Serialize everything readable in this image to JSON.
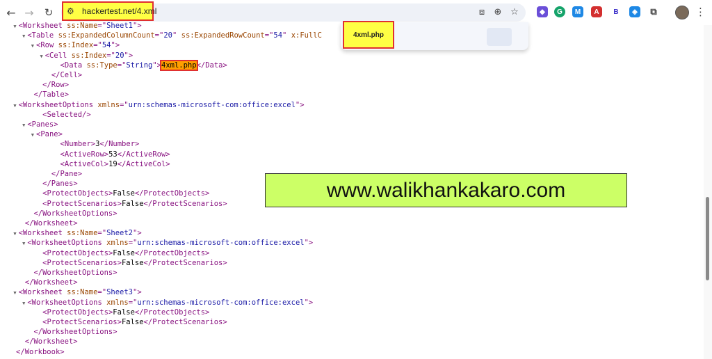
{
  "browser": {
    "url": "hackertest.net/4.xml",
    "back_icon": "←",
    "forward_icon": "→",
    "reload_icon": "↻",
    "site_info_icon": "⚙",
    "menu_icon": "⋮"
  },
  "find_popup": {
    "text": "4xml.php"
  },
  "xml_lines": [
    {
      "indent": 4,
      "tri": "▼",
      "segs": [
        [
          "tag",
          "<Worksheet "
        ],
        [
          "attr",
          "ss:Name"
        ],
        [
          "tag",
          "=\""
        ],
        [
          "val",
          "Sheet1"
        ],
        [
          "tag",
          "\">"
        ]
      ]
    },
    {
      "indent": 6,
      "tri": "▼",
      "segs": [
        [
          "tag",
          "<Table "
        ],
        [
          "attr",
          "ss:ExpandedColumnCount"
        ],
        [
          "tag",
          "=\""
        ],
        [
          "val",
          "20"
        ],
        [
          "tag",
          "\" "
        ],
        [
          "attr",
          "ss:ExpandedRowCount"
        ],
        [
          "tag",
          "=\""
        ],
        [
          "val",
          "54"
        ],
        [
          "tag",
          "\" "
        ],
        [
          "attr",
          "x:FullC"
        ]
      ]
    },
    {
      "indent": 8,
      "tri": "▼",
      "segs": [
        [
          "tag",
          "<Row "
        ],
        [
          "attr",
          "ss:Index"
        ],
        [
          "tag",
          "=\""
        ],
        [
          "val",
          "54"
        ],
        [
          "tag",
          "\">"
        ]
      ]
    },
    {
      "indent": 10,
      "tri": "▼",
      "segs": [
        [
          "tag",
          "<Cell "
        ],
        [
          "attr",
          "ss:Index"
        ],
        [
          "tag",
          "=\""
        ],
        [
          "val",
          "20"
        ],
        [
          "tag",
          "\">"
        ]
      ]
    },
    {
      "indent": 13,
      "tri": "",
      "segs": [
        [
          "tag",
          "<Data "
        ],
        [
          "attr",
          "ss:Type"
        ],
        [
          "tag",
          "=\""
        ],
        [
          "val",
          "String"
        ],
        [
          "tag",
          "\">"
        ],
        [
          "hl",
          "4xml.php"
        ],
        [
          "tag",
          "</Data>"
        ]
      ]
    },
    {
      "indent": 11,
      "tri": "",
      "segs": [
        [
          "tag",
          "</Cell>"
        ]
      ]
    },
    {
      "indent": 9,
      "tri": "",
      "segs": [
        [
          "tag",
          "</Row>"
        ]
      ]
    },
    {
      "indent": 7,
      "tri": "",
      "segs": [
        [
          "tag",
          "</Table>"
        ]
      ]
    },
    {
      "indent": 4,
      "tri": "▼",
      "segs": [
        [
          "tag",
          "<WorksheetOptions "
        ],
        [
          "attr",
          "xmlns"
        ],
        [
          "tag",
          "=\""
        ],
        [
          "val",
          "urn:schemas-microsoft-com:office:excel"
        ],
        [
          "tag",
          "\">"
        ]
      ]
    },
    {
      "indent": 9,
      "tri": "",
      "segs": [
        [
          "tag",
          "<Selected/>"
        ]
      ]
    },
    {
      "indent": 6,
      "tri": "▼",
      "segs": [
        [
          "tag",
          "<Panes>"
        ]
      ]
    },
    {
      "indent": 8,
      "tri": "▼",
      "segs": [
        [
          "tag",
          "<Pane>"
        ]
      ]
    },
    {
      "indent": 13,
      "tri": "",
      "segs": [
        [
          "tag",
          "<Number>"
        ],
        [
          "txt",
          "3"
        ],
        [
          "tag",
          "</Number>"
        ]
      ]
    },
    {
      "indent": 13,
      "tri": "",
      "segs": [
        [
          "tag",
          "<ActiveRow>"
        ],
        [
          "txt",
          "53"
        ],
        [
          "tag",
          "</ActiveRow>"
        ]
      ]
    },
    {
      "indent": 13,
      "tri": "",
      "segs": [
        [
          "tag",
          "<ActiveCol>"
        ],
        [
          "txt",
          "19"
        ],
        [
          "tag",
          "</ActiveCol>"
        ]
      ]
    },
    {
      "indent": 11,
      "tri": "",
      "segs": [
        [
          "tag",
          "</Pane>"
        ]
      ]
    },
    {
      "indent": 9,
      "tri": "",
      "segs": [
        [
          "tag",
          "</Panes>"
        ]
      ]
    },
    {
      "indent": 9,
      "tri": "",
      "segs": [
        [
          "tag",
          "<ProtectObjects>"
        ],
        [
          "txt",
          "False"
        ],
        [
          "tag",
          "</ProtectObjects>"
        ]
      ]
    },
    {
      "indent": 9,
      "tri": "",
      "segs": [
        [
          "tag",
          "<ProtectScenarios>"
        ],
        [
          "txt",
          "False"
        ],
        [
          "tag",
          "</ProtectScenarios>"
        ]
      ]
    },
    {
      "indent": 7,
      "tri": "",
      "segs": [
        [
          "tag",
          "</WorksheetOptions>"
        ]
      ]
    },
    {
      "indent": 5,
      "tri": "",
      "segs": [
        [
          "tag",
          "</Worksheet>"
        ]
      ]
    },
    {
      "indent": 4,
      "tri": "▼",
      "segs": [
        [
          "tag",
          "<Worksheet "
        ],
        [
          "attr",
          "ss:Name"
        ],
        [
          "tag",
          "=\""
        ],
        [
          "val",
          "Sheet2"
        ],
        [
          "tag",
          "\">"
        ]
      ]
    },
    {
      "indent": 6,
      "tri": "▼",
      "segs": [
        [
          "tag",
          "<WorksheetOptions "
        ],
        [
          "attr",
          "xmlns"
        ],
        [
          "tag",
          "=\""
        ],
        [
          "val",
          "urn:schemas-microsoft-com:office:excel"
        ],
        [
          "tag",
          "\">"
        ]
      ]
    },
    {
      "indent": 9,
      "tri": "",
      "segs": [
        [
          "tag",
          "<ProtectObjects>"
        ],
        [
          "txt",
          "False"
        ],
        [
          "tag",
          "</ProtectObjects>"
        ]
      ]
    },
    {
      "indent": 9,
      "tri": "",
      "segs": [
        [
          "tag",
          "<ProtectScenarios>"
        ],
        [
          "txt",
          "False"
        ],
        [
          "tag",
          "</ProtectScenarios>"
        ]
      ]
    },
    {
      "indent": 7,
      "tri": "",
      "segs": [
        [
          "tag",
          "</WorksheetOptions>"
        ]
      ]
    },
    {
      "indent": 5,
      "tri": "",
      "segs": [
        [
          "tag",
          "</Worksheet>"
        ]
      ]
    },
    {
      "indent": 4,
      "tri": "▼",
      "segs": [
        [
          "tag",
          "<Worksheet "
        ],
        [
          "attr",
          "ss:Name"
        ],
        [
          "tag",
          "=\""
        ],
        [
          "val",
          "Sheet3"
        ],
        [
          "tag",
          "\">"
        ]
      ]
    },
    {
      "indent": 6,
      "tri": "▼",
      "segs": [
        [
          "tag",
          "<WorksheetOptions "
        ],
        [
          "attr",
          "xmlns"
        ],
        [
          "tag",
          "=\""
        ],
        [
          "val",
          "urn:schemas-microsoft-com:office:excel"
        ],
        [
          "tag",
          "\">"
        ]
      ]
    },
    {
      "indent": 9,
      "tri": "",
      "segs": [
        [
          "tag",
          "<ProtectObjects>"
        ],
        [
          "txt",
          "False"
        ],
        [
          "tag",
          "</ProtectObjects>"
        ]
      ]
    },
    {
      "indent": 9,
      "tri": "",
      "segs": [
        [
          "tag",
          "<ProtectScenarios>"
        ],
        [
          "txt",
          "False"
        ],
        [
          "tag",
          "</ProtectScenarios>"
        ]
      ]
    },
    {
      "indent": 7,
      "tri": "",
      "segs": [
        [
          "tag",
          "</WorksheetOptions>"
        ]
      ]
    },
    {
      "indent": 5,
      "tri": "",
      "segs": [
        [
          "tag",
          "</Worksheet>"
        ]
      ]
    },
    {
      "indent": 3,
      "tri": "",
      "segs": [
        [
          "tag",
          "</Workbook>"
        ]
      ]
    }
  ],
  "banner": {
    "text": "www.walikhankakaro.com"
  },
  "extensions": [
    {
      "name": "extension-purple-icon",
      "glyph": "◆",
      "color": "#6b4fd8"
    },
    {
      "name": "grammarly-icon",
      "glyph": "G",
      "color": "#15a36a"
    },
    {
      "name": "extension-m-icon",
      "glyph": "M",
      "color": "#1e88e5"
    },
    {
      "name": "pdf-icon",
      "glyph": "A",
      "color": "#d32f2f"
    },
    {
      "name": "extension-b-icon",
      "glyph": "B",
      "color": "#ffffff"
    },
    {
      "name": "tag-icon",
      "glyph": "◈",
      "color": "#1e88e5"
    },
    {
      "name": "puzzle-icon",
      "glyph": "⧉",
      "color": "#ffffff"
    }
  ]
}
